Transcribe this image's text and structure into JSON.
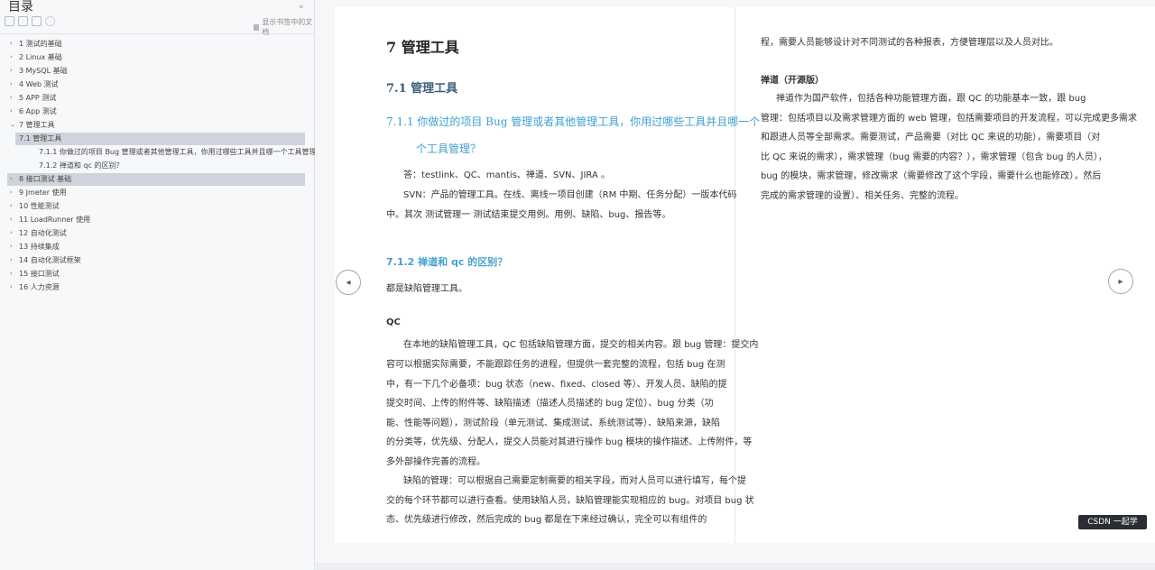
{
  "sidebar": {
    "title": "目录",
    "collapse_glyph": "«",
    "right_tool_label": "显示书签中的文档",
    "toc": [
      {
        "label": "1 测试的基础",
        "chev": "›",
        "level": 0
      },
      {
        "label": "2 Linux 基础",
        "chev": "›",
        "level": 0
      },
      {
        "label": "3 MySQL 基础",
        "chev": "›",
        "level": 0
      },
      {
        "label": "4 Web 测试",
        "chev": "›",
        "level": 0
      },
      {
        "label": "5 APP 测试",
        "chev": "›",
        "level": 0
      },
      {
        "label": "6 App 测试",
        "chev": "›",
        "level": 0
      },
      {
        "label": "7 管理工具",
        "chev": "⌄",
        "level": 0
      },
      {
        "label": "7.1 管理工具",
        "chev": "",
        "level": 1,
        "selected": true
      },
      {
        "label": "7.1.1 你做过的项目 Bug 管理或者其他管理工具，你用过哪些工具并且哪一个工具管理？",
        "chev": "",
        "level": 2
      },
      {
        "label": "7.1.2 禅道和 qc 的区别？",
        "chev": "",
        "level": 2
      },
      {
        "label": "8 接口测试 基础",
        "chev": "›",
        "level": 0,
        "selected": true
      },
      {
        "label": "9 Jmeter 使用",
        "chev": "›",
        "level": 0
      },
      {
        "label": "10 性能测试",
        "chev": "›",
        "level": 0
      },
      {
        "label": "11 LoadRunner 使用",
        "chev": "›",
        "level": 0
      },
      {
        "label": "12 自动化测试",
        "chev": "›",
        "level": 0
      },
      {
        "label": "13 持续集成",
        "chev": "›",
        "level": 0
      },
      {
        "label": "14 自动化测试框架",
        "chev": "›",
        "level": 0
      },
      {
        "label": "15 接口测试",
        "chev": "›",
        "level": 0
      },
      {
        "label": "16 人力资源",
        "chev": "›",
        "level": 0
      }
    ]
  },
  "document": {
    "h1": "7  管理工具",
    "h2": "7.1 管理工具",
    "q1_line1": "7.1.1  你做过的项目 Bug 管理或者其他管理工具，你用过哪些工具并且哪一个",
    "q1_line2": "个工具管理？",
    "answer_line1": "答：testlink、QC、mantis、禅道、SVN、JIRA 。",
    "answer_line2": "SVN：产品的管理工具。在线、离线一项目创建（RM 中期、任务分配）一版本代码",
    "answer_line3": "中。其次 测试管理一 测试结束提交用例。用例、缺陷、bug、报告等。",
    "q2": "7.1.2  禅道和 qc 的区别？",
    "q2_answer": "都是缺陷管理工具。",
    "qc_label": "QC",
    "qc_lines": [
      "在本地的缺陷管理工具，QC 包括缺陷管理方面，提交的相关内容。跟 bug 管理：提交内",
      "容可以根据实际需要，不能跟踪任务的进程，但提供一套完整的流程，包括 bug 在测",
      "中，有一下几个必备项：bug 状态（new、fixed、closed 等）、开发人员、缺陷的提",
      "提交时间、上传的附件等、缺陷描述（描述人员描述的 bug 定位）、bug 分类（功",
      "能、性能等问题），测试阶段（单元测试、集成测试、系统测试等）、缺陷来源，缺陷",
      "的分类等，优先级、分配人，提交人员能对其进行操作 bug 模块的操作描述、上传附件，等",
      "多外部操作完善的流程。"
    ],
    "qc_lines2": [
      "缺陷的管理：可以根据自己需要定制需要的相关字段，而对人员可以进行填写，每个提",
      "交的每个环节都可以进行查看。使用缺陷人员，缺陷管理能实现相应的 bug。对项目 bug 状",
      "态、优先级进行修改，然后完成的 bug 都是在下来经过确认，完全可以有组件的"
    ],
    "right_line0": "程，需要人员能够设计对不同测试的各种报表，方便管理层以及人员对比。",
    "right_heading": "禅道（开源版）",
    "right_lines": [
      "禅道作为国产软件，包括各种功能管理方面，跟 QC 的功能基本一致，跟 bug",
      "管理：包括项目以及需求管理方面的 web 管理，包括需要项目的开发流程，可以完成更多需求",
      "和跟进人员等全部需求。需要测试，产品需要（对比 QC 来说的功能），需要项目（对",
      "比 QC 来说的需求），需求管理（bug 需要的内容？），需求管理（包含 bug 的人员），",
      "bug 的模块，需求管理，修改需求（需要修改了这个字段，需要什么也能修改），然后",
      "完成的需求管理的设置）、相关任务、完整的流程。"
    ],
    "prev_glyph": "◂",
    "next_glyph": "▸",
    "watermark": "CSDN 一起学"
  }
}
